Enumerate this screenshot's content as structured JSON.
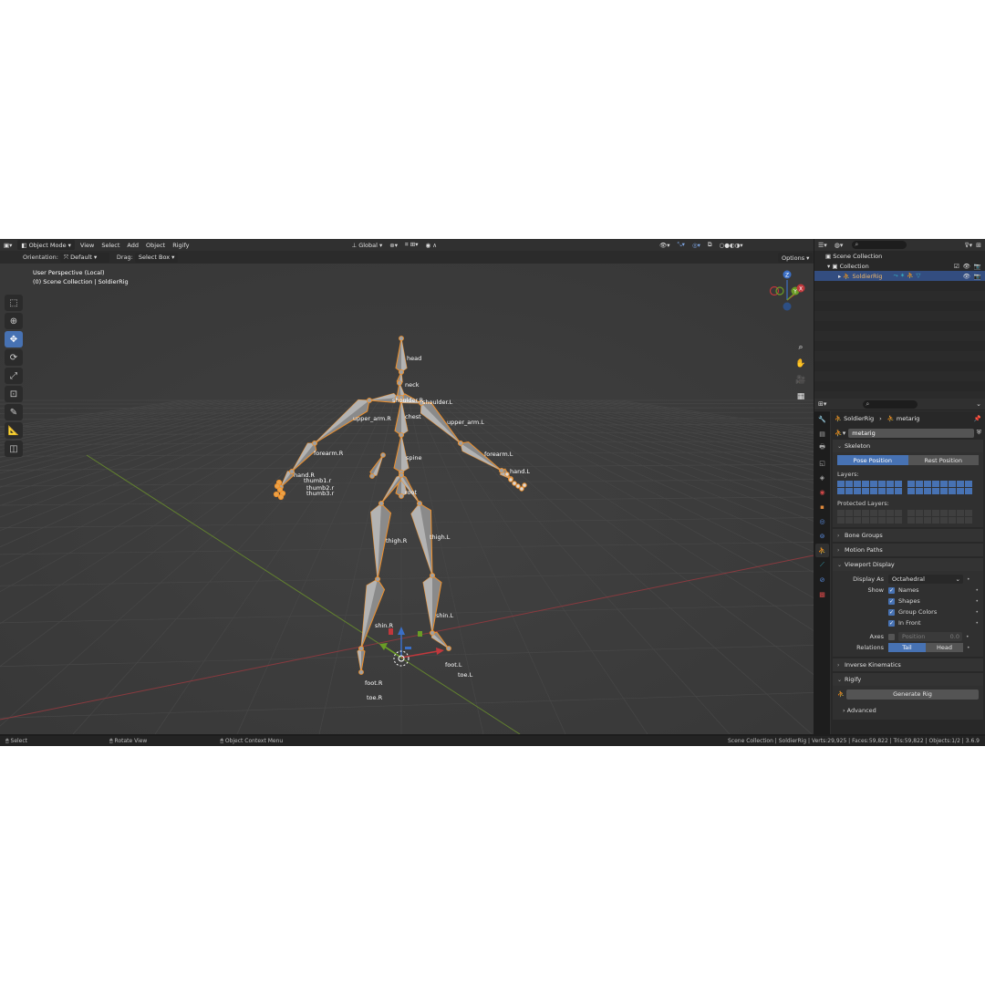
{
  "header": {
    "mode": "Object Mode",
    "menus": [
      "View",
      "Select",
      "Add",
      "Object",
      "Rigify"
    ],
    "transform": "Global"
  },
  "tool_header": {
    "orientation_label": "Orientation:",
    "orientation_value": "Default",
    "drag_label": "Drag:",
    "drag_value": "Select Box",
    "options": "Options"
  },
  "viewport": {
    "perspective": "User Perspective (Local)",
    "collection_path": "(0) Scene Collection | SoldierRig",
    "bones": [
      "head",
      "neck",
      "shoulder.R",
      "shoulder.L",
      "upper_arm.R",
      "chest",
      "upper_arm.L",
      "forearm.R",
      "spine",
      "forearm.L",
      "hand.R",
      "hand.L",
      "thumb1.r",
      "thumb2.r",
      "thumb3.r",
      "root",
      "thigh.R",
      "thigh.L",
      "shin.R",
      "shin.L",
      "foot.L",
      "toe.L",
      "foot.R",
      "toe.R"
    ],
    "gizmo_axes": [
      "Z",
      "Y",
      "X"
    ]
  },
  "outliner": {
    "rows": [
      {
        "label": "Scene Collection"
      },
      {
        "label": "Collection"
      },
      {
        "label": "SoldierRig"
      }
    ]
  },
  "properties": {
    "breadcrumb_object": "SoldierRig",
    "breadcrumb_data": "metarig",
    "name_field": "metarig",
    "skeleton": {
      "title": "Skeleton",
      "pose_position": "Pose Position",
      "rest_position": "Rest Position",
      "layers_label": "Layers:",
      "protected_label": "Protected Layers:"
    },
    "bone_groups": "Bone Groups",
    "motion_paths": "Motion Paths",
    "viewport_display": {
      "title": "Viewport Display",
      "display_as_label": "Display As",
      "display_as_value": "Octahedral",
      "show_label": "Show",
      "names": "Names",
      "shapes": "Shapes",
      "group_colors": "Group Colors",
      "in_front": "In Front",
      "axes_label": "Axes",
      "position_label": "Position",
      "position_value": "0.0",
      "relations_label": "Relations",
      "tail": "Tail",
      "head": "Head"
    },
    "inverse_kinematics": "Inverse Kinematics",
    "rigify": {
      "title": "Rigify",
      "generate": "Generate Rig",
      "advanced": "Advanced"
    }
  },
  "status_bar": {
    "select": "Select",
    "rotate": "Rotate View",
    "context": "Object Context Menu",
    "stats": "Scene Collection | SoldierRig | Verts:29,925 | Faces:59,822 | Tris:59,822 | Objects:1/2 | 3.6.9"
  },
  "colors": {
    "accent": "#4772b3",
    "bone_outline": "#f0902a",
    "x_axis": "#c0383c",
    "y_axis": "#6a9c26",
    "z_axis": "#3b6fc6"
  }
}
